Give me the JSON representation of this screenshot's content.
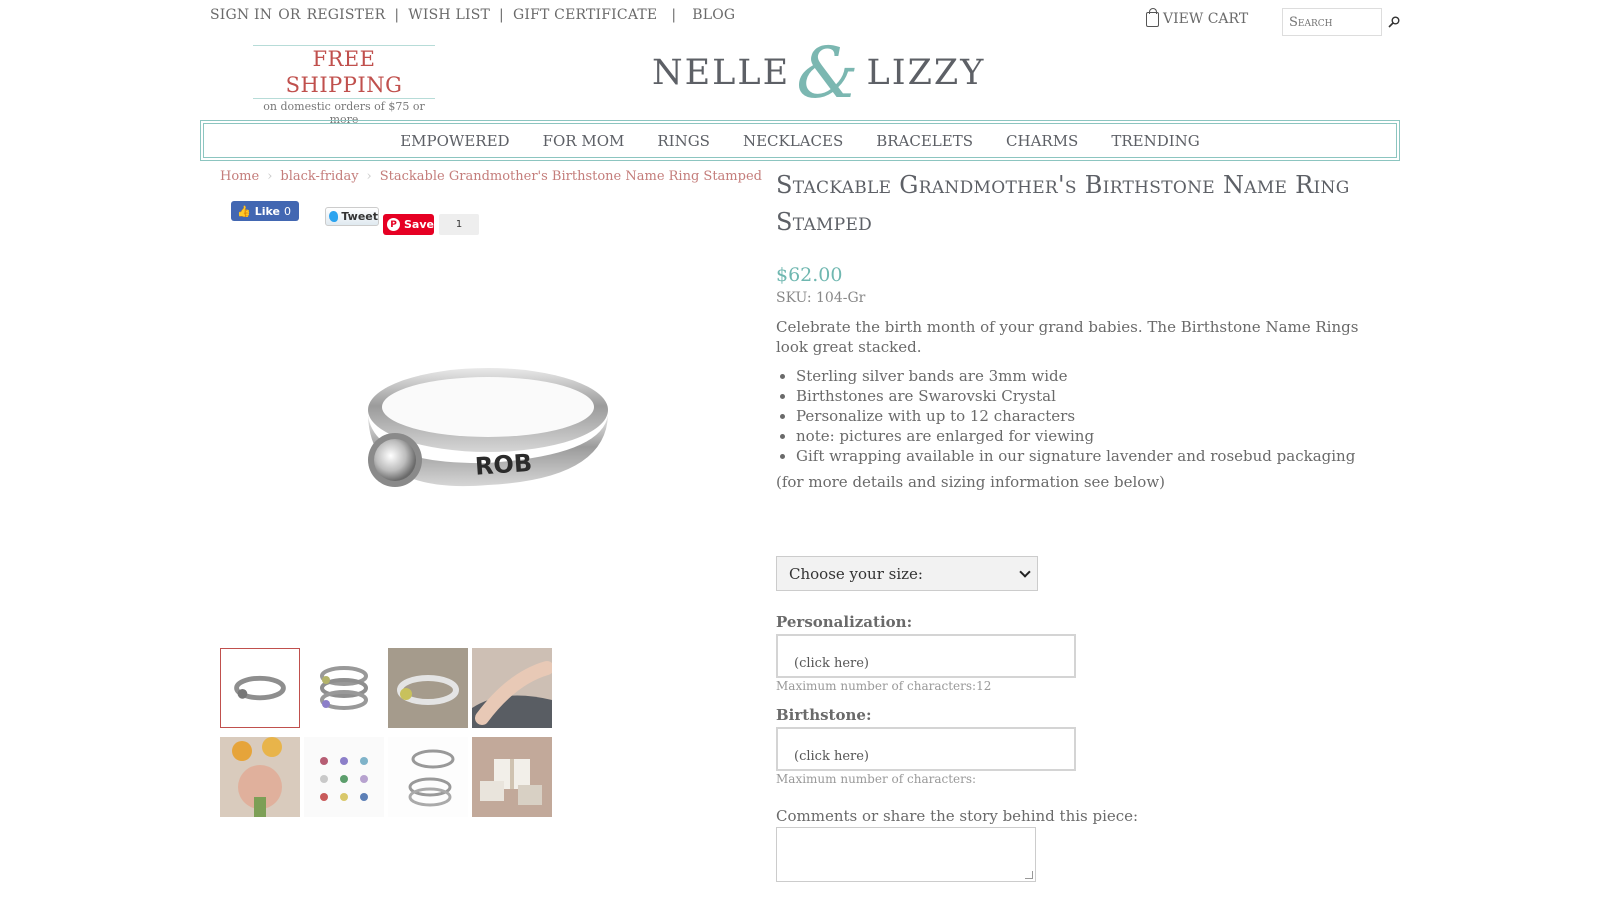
{
  "topbar": {
    "sign_in": "SIGN IN",
    "or": "OR",
    "register": "REGISTER",
    "wish_list": "WISH LIST",
    "gift_certificate": "GIFT CERTIFICATE",
    "blog": "BLOG",
    "separator": "|"
  },
  "cart": {
    "label": "VIEW CART",
    "icon": "shopping-bag-icon"
  },
  "search": {
    "placeholder": "Search",
    "icon": "magnifier-icon"
  },
  "promo": {
    "title": "FREE SHIPPING",
    "subtitle": "on domestic orders of $75 or more"
  },
  "logo": {
    "left": "NELLE",
    "amp": "&",
    "right": "LIZZY"
  },
  "nav": {
    "items": [
      "EMPOWERED",
      "FOR MOM",
      "RINGS",
      "NECKLACES",
      "BRACELETS",
      "CHARMS",
      "TRENDING"
    ]
  },
  "breadcrumb": {
    "home": "Home",
    "category": "black-friday",
    "current": "Stackable Grandmother's Birthstone Name Ring Stamped"
  },
  "social": {
    "like": "Like",
    "like_count": "0",
    "tweet": "Tweet",
    "save": "Save",
    "save_count": "1"
  },
  "main_image": {
    "engraving": "ROB"
  },
  "product": {
    "title": "Stackable Grandmother's Birthstone Name Ring Stamped",
    "price": "$62.00",
    "sku": "SKU: 104-Gr",
    "description": "Celebrate the birth month of your grand babies. The Birthstone Name Rings look great stacked.",
    "bullets": [
      "Sterling silver bands are 3mm wide",
      "Birthstones are Swarovski Crystal",
      "Personalize with up to 12 characters",
      "note: pictures are enlarged for viewing",
      "Gift wrapping available in our signature lavender and rosebud packaging"
    ],
    "more_info": "(for more details and sizing information see below)"
  },
  "options": {
    "size_select": "Choose your size:",
    "personalization_label": "Personalization:",
    "personalization_value": "(click here)",
    "personalization_hint": "Maximum number of characters:12",
    "birthstone_label": "Birthstone:",
    "birthstone_value": "(click here)",
    "birthstone_hint": "Maximum number of characters:",
    "comments_label": "Comments or share the story behind this piece:"
  },
  "colors": {
    "accent_teal": "#6fb7b0",
    "accent_rose": "#c0504d",
    "text": "#6a6a6a"
  }
}
